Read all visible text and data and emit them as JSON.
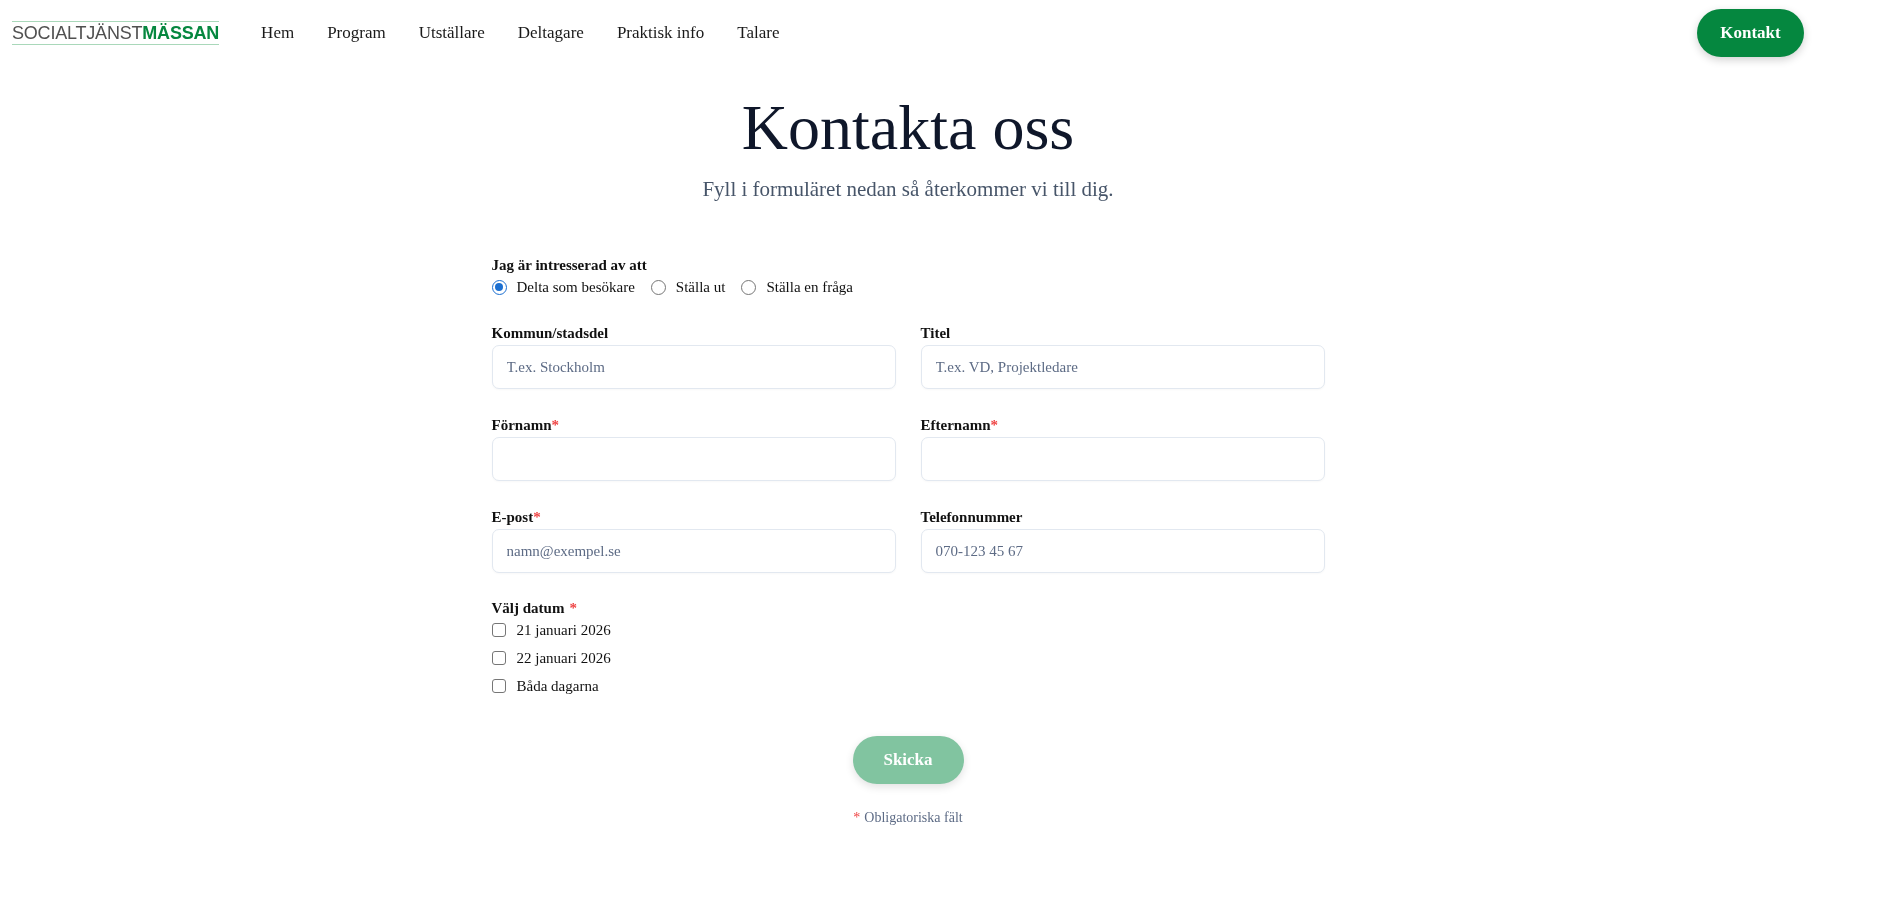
{
  "header": {
    "logo": {
      "light": "SOCIALTJÄNST",
      "bold": "MÄSSAN"
    },
    "nav": [
      "Hem",
      "Program",
      "Utställare",
      "Deltagare",
      "Praktisk info",
      "Talare"
    ],
    "cta": "Kontakt"
  },
  "page": {
    "title": "Kontakta oss",
    "subtitle": "Fyll i formuläret nedan så återkommer vi till dig."
  },
  "form": {
    "interest": {
      "label": "Jag är intresserad av att",
      "options": [
        {
          "label": "Delta som besökare",
          "selected": true
        },
        {
          "label": "Ställa ut",
          "selected": false
        },
        {
          "label": "Ställa en fråga",
          "selected": false
        }
      ]
    },
    "fields": [
      {
        "label": "Kommun/stadsdel",
        "placeholder": "T.ex. Stockholm"
      },
      {
        "label": "Titel",
        "placeholder": "T.ex. VD, Projektledare"
      },
      {
        "label": "Förnamn",
        "required_mark": "*"
      },
      {
        "label": "Efternamn",
        "required_mark": "*"
      },
      {
        "label": "E-post",
        "required_mark": "*",
        "placeholder": "namn@exempel.se"
      },
      {
        "label": "Telefonnummer",
        "placeholder": "070-123 45 67"
      }
    ],
    "dates": {
      "label": "Välj datum",
      "required_mark": "*",
      "options": [
        {
          "label": "21 januari 2026",
          "checked": false
        },
        {
          "label": "22 januari 2026",
          "checked": false
        },
        {
          "label": "Båda dagarna",
          "checked": false
        }
      ]
    },
    "submit": {
      "label": "Skicka",
      "disabled": true
    },
    "footnote": {
      "mark": "*",
      "text": "Obligatoriska fält"
    }
  }
}
